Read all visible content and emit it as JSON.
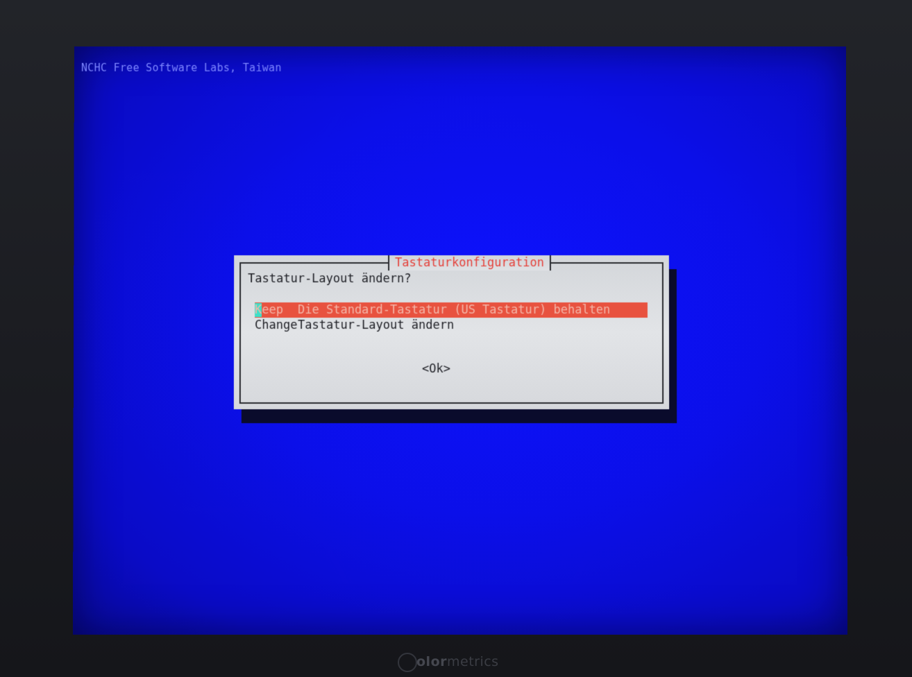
{
  "screen": {
    "header": "NCHC Free Software Labs, Taiwan",
    "background_color": "#0b0fe9"
  },
  "dialog": {
    "title": "Tastaturkonfiguration",
    "prompt": "Tastatur-Layout ändern?",
    "options": [
      {
        "tag_hotkey": "K",
        "tag_rest": "eep",
        "description": "Die Standard-Tastatur (US Tastatur) behalten",
        "selected": true
      },
      {
        "tag_hotkey": "C",
        "tag_rest": "hange",
        "description": "Tastatur-Layout ändern",
        "selected": false
      }
    ],
    "ok_label": "<Ok>",
    "colors": {
      "title": "#e5413a",
      "selection": "#e8523f",
      "hotkey_highlight": "#3ee0c8"
    }
  },
  "watermark": {
    "bold": "olor",
    "rest": "metrics"
  }
}
